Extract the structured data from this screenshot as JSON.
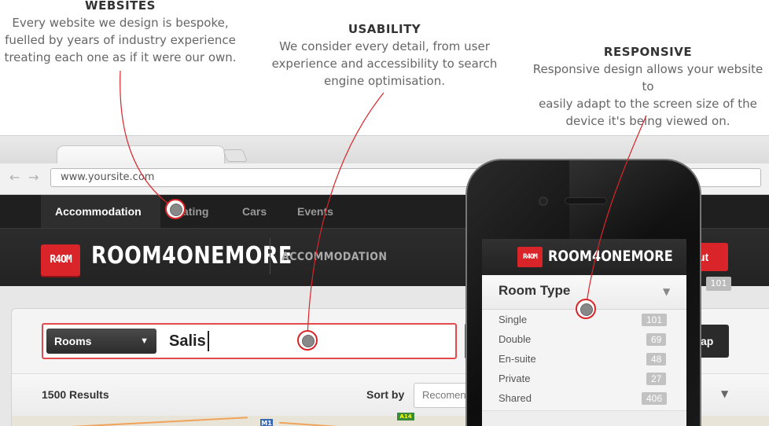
{
  "features": [
    {
      "title": "WEBSITES",
      "text": "Every website we design is bespoke,\nfuelled by years of industry experience\ntreating each one as if it were our own."
    },
    {
      "title": "USABILITY",
      "text": "We consider every detail, from user\nexperience and accessibility to search\nengine optimisation."
    },
    {
      "title": "RESPONSIVE",
      "text": "Responsive design allows your website to\neasily adapt to the screen size of the\ndevice it's being viewed on."
    }
  ],
  "browser": {
    "url": "www.yoursite.com",
    "back_icon": "left-arrow-icon",
    "forward_icon": "right-arrow-icon"
  },
  "site": {
    "nav": [
      "Accommodation",
      "Eating",
      "Cars",
      "Events"
    ],
    "nav_visible_partial": "ating",
    "logo_text": "R4OM",
    "brand": "ROOM4ONEMORE",
    "section": "ACCOMMODATION",
    "header_button": "ut",
    "search": {
      "select_value": "Rooms",
      "query": "Salis"
    },
    "map_button": "ap",
    "results_label": "1500 Results",
    "sort_label": "Sort by",
    "sort_value": "Recomen",
    "map_labels": {
      "m1": "M1",
      "a14": "A14"
    },
    "background_badge": "101"
  },
  "phone": {
    "logo_text": "R4OM",
    "brand": "ROOM4ONEMORE",
    "filter_title": "Room Type",
    "room_types": [
      {
        "label": "Single",
        "count": "101"
      },
      {
        "label": "Double",
        "count": "69"
      },
      {
        "label": "En-suite",
        "count": "48"
      },
      {
        "label": "Private",
        "count": "27"
      },
      {
        "label": "Shared",
        "count": "406"
      }
    ]
  },
  "colors": {
    "accent_red": "#d9252a",
    "dark_nav": "#1f1f1f",
    "marker_grey": "#888888"
  }
}
